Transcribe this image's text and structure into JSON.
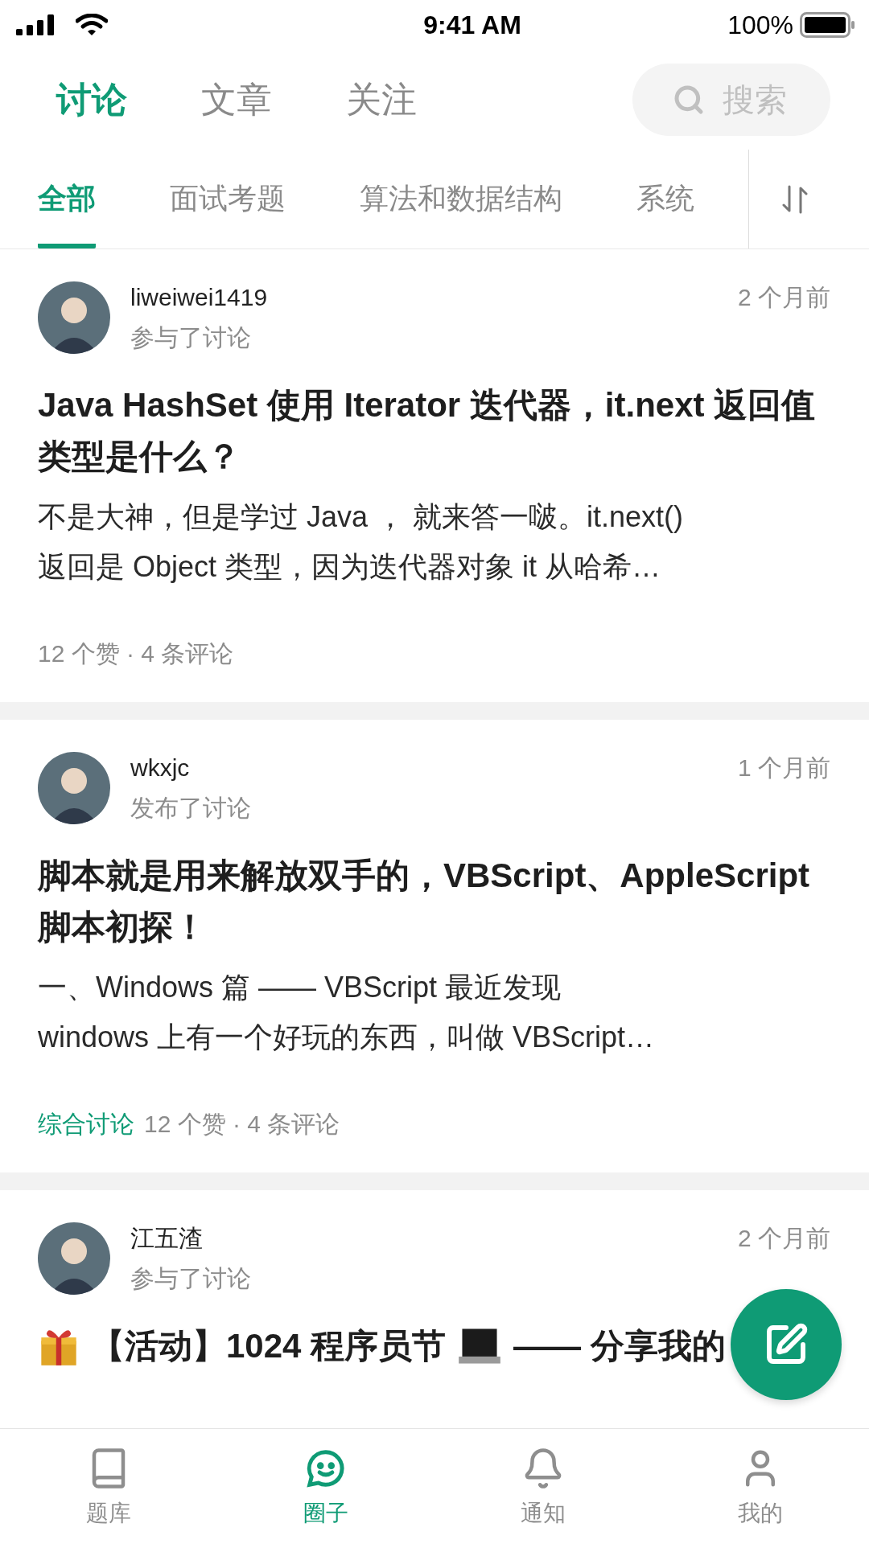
{
  "status_bar": {
    "time": "9:41 AM",
    "battery": "100%"
  },
  "top_tabs": [
    {
      "label": "讨论",
      "selected": true
    },
    {
      "label": "文章",
      "selected": false
    },
    {
      "label": "关注",
      "selected": false
    }
  ],
  "search": {
    "placeholder": "搜索"
  },
  "category_tabs": [
    {
      "label": "全部",
      "selected": true
    },
    {
      "label": "面试考题",
      "selected": false
    },
    {
      "label": "算法和数据结构",
      "selected": false
    },
    {
      "label": "系统",
      "selected": false
    }
  ],
  "posts": [
    {
      "user": "liweiwei1419",
      "action": "参与了讨论",
      "time": "2 个月前",
      "title_parts": [
        {
          "kind": "text",
          "text": "Java HashSet 使用 Iterator 迭代器，it.next 返回值类型是什么？"
        }
      ],
      "excerpt": "不是大神，但是学过 Java ， 就来答一啵。it.next()\n返回是 Object 类型，因为迭代器对象 it 从哈希…",
      "stats": "12 个赞 · 4 条评论"
    },
    {
      "user": "wkxjc",
      "action": "发布了讨论",
      "time": "1 个月前",
      "title_parts": [
        {
          "kind": "text",
          "text": "脚本就是用来解放双手的，VBScript、AppleScript 脚本初探！"
        }
      ],
      "excerpt": "一、Windows 篇 —— VBScript 最近发现\nwindows 上有一个好玩的东西，叫做 VBScript…",
      "tag": "综合讨论",
      "stats": "12 个赞 · 4 条评论"
    },
    {
      "user": "江五渣",
      "action": "参与了讨论",
      "time": "2 个月前",
      "title_parts": [
        {
          "kind": "gift"
        },
        {
          "kind": "text",
          "text": "【活动】1024 程序员节"
        },
        {
          "kind": "laptop"
        },
        {
          "kind": "text",
          "text": "—— 分享我的"
        }
      ]
    }
  ],
  "bottom_tabs": [
    {
      "kind": "book",
      "label": "题库",
      "selected": false
    },
    {
      "kind": "chat",
      "label": "圈子",
      "selected": true
    },
    {
      "kind": "bell",
      "label": "通知",
      "selected": false
    },
    {
      "kind": "user",
      "label": "我的",
      "selected": false
    }
  ]
}
